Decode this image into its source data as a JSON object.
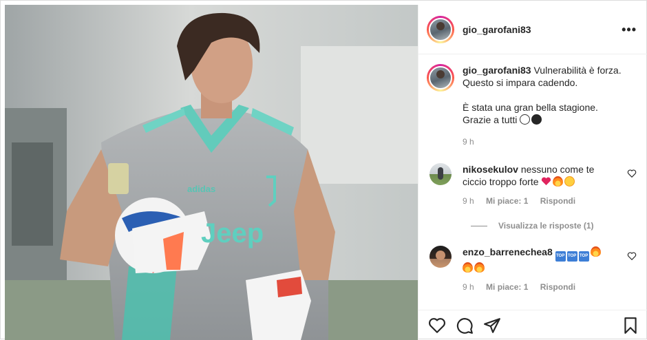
{
  "post": {
    "author": "gio_garofani83",
    "more_label": "•••"
  },
  "caption": {
    "author": "gio_garofani83",
    "line1": "Vulnerabilità è forza.",
    "line2": "Questo si impara cadendo.",
    "line3": "È stata una gran bella stagione.",
    "line4": "Grazie a tutti",
    "time": "9 h"
  },
  "comments": [
    {
      "author": "nikosekulov",
      "text_line1": "nessuno come te",
      "text_line2": "ciccio troppo forte",
      "time": "9 h",
      "likes": "Mi piace: 1",
      "reply_label": "Rispondi"
    },
    {
      "author": "enzo_barrenechea8",
      "time": "9 h",
      "likes": "Mi piace: 1",
      "reply_label": "Rispondi"
    }
  ],
  "view_replies_label": "Visualizza le risposte (1)",
  "photo": {
    "kit_brand": "adidas",
    "kit_sponsor": "Jeep"
  },
  "icons": {
    "like": "heart-icon",
    "comment": "comment-icon",
    "share": "paper-plane-icon",
    "save": "bookmark-icon",
    "more": "more-icon"
  },
  "colors": {
    "border": "#dbdbdb",
    "muted": "#8e8e8e",
    "text": "#262626",
    "kit_gray": "#a9acae",
    "kit_teal": "#6fd3c4",
    "heart_red": "#e0245e"
  }
}
